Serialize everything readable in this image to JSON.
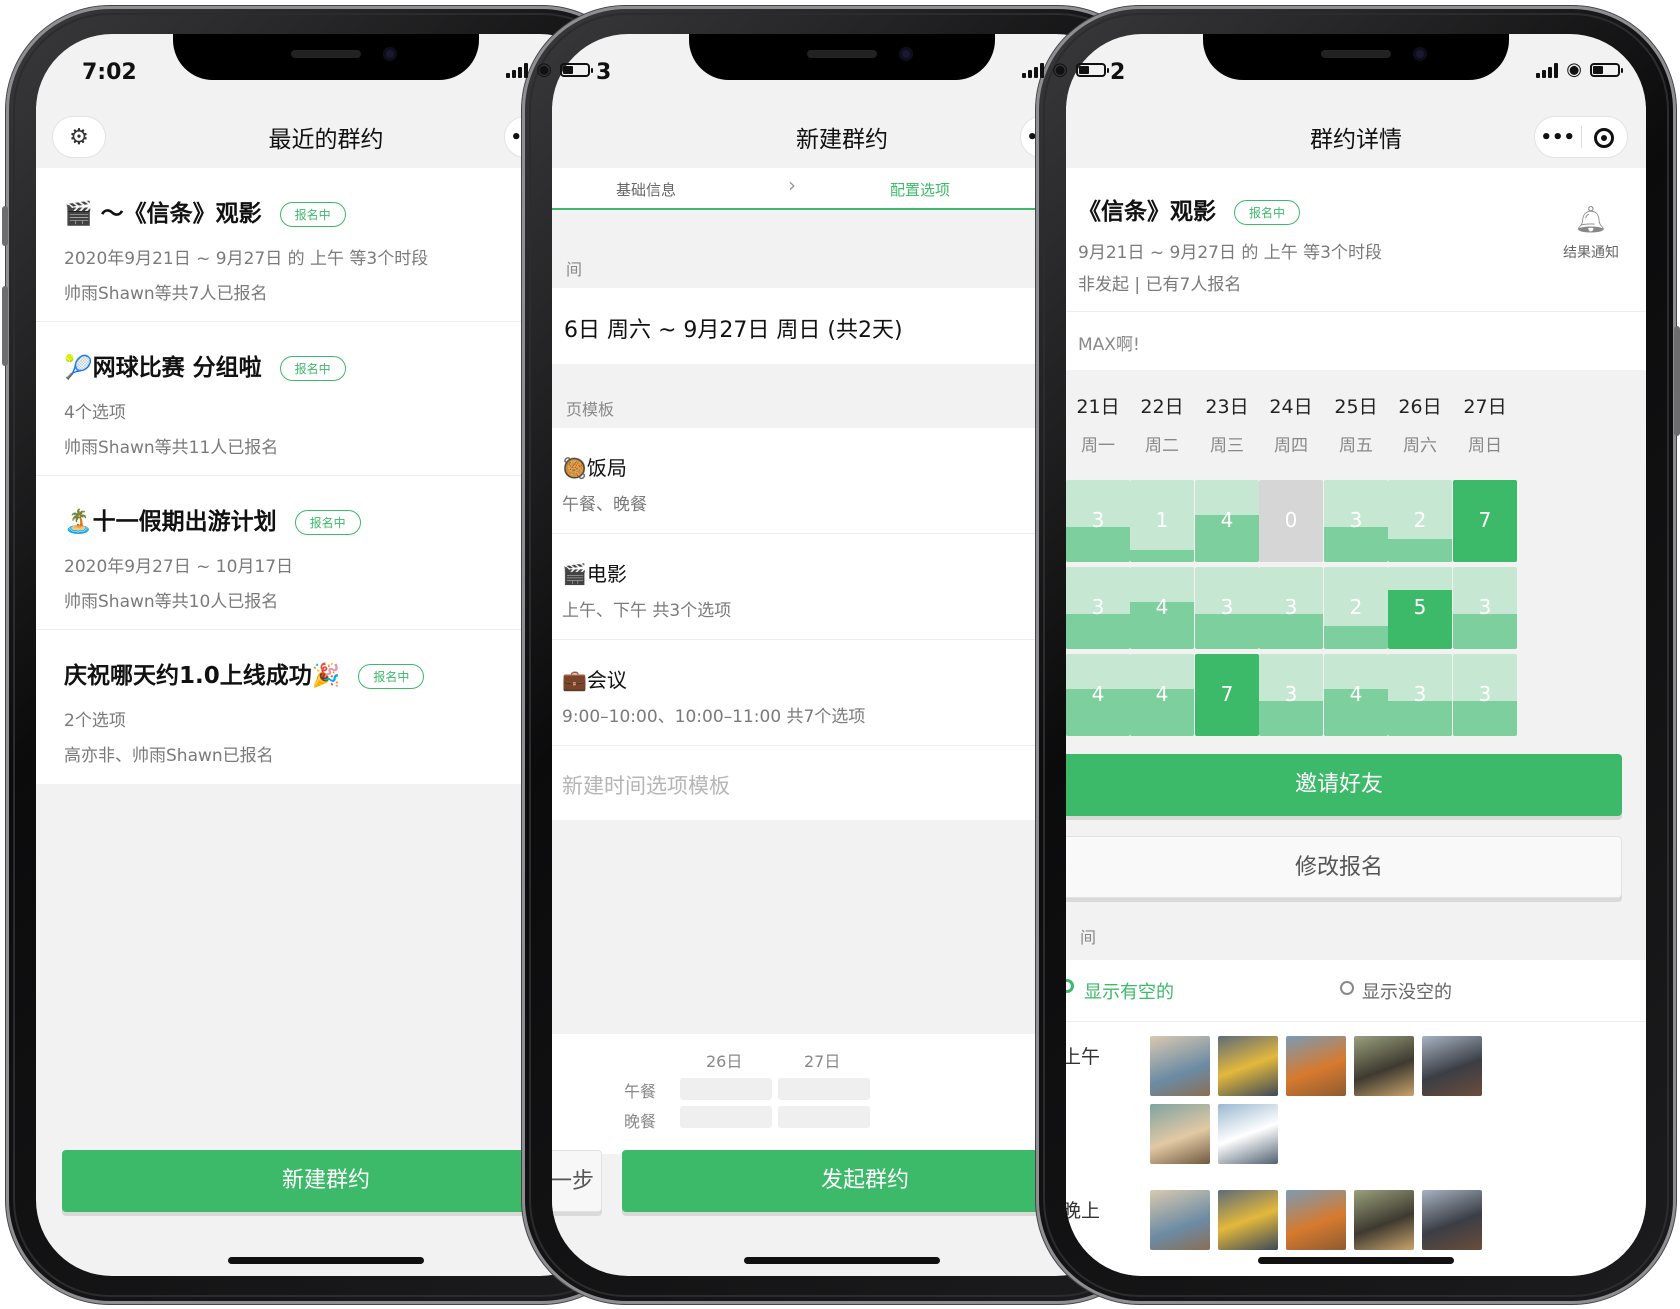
{
  "status": {
    "time": "7:02",
    "time2": "3",
    "time3": "2"
  },
  "phone1": {
    "title": "最近的群约",
    "items": [
      {
        "title": "🎬 ～《信条》观影",
        "badge": "报名中",
        "sub": "2020年9月21日 ~ 9月27日 的 上午 等3个时段",
        "sub2": "帅雨Shawn等共7人已报名"
      },
      {
        "title": "🎾网球比赛 分组啦",
        "badge": "报名中",
        "sub": "4个选项",
        "sub2": "帅雨Shawn等共11人已报名"
      },
      {
        "title": "🏝️十一假期出游计划",
        "badge": "报名中",
        "sub": "2020年9月27日 ~ 10月17日",
        "sub2": "帅雨Shawn等共10人已报名"
      },
      {
        "title": "庆祝哪天约1.0上线成功🎉",
        "badge": "报名中",
        "sub": "2个选项",
        "sub2": "高亦非、帅雨Shawn已报名"
      }
    ],
    "new_button": "新建群约"
  },
  "phone2": {
    "title": "新建群约",
    "step1": "基础信息",
    "step2": "配置选项",
    "label_date": "间",
    "date_range": "6日 周六 ~ 9月27日 周日 (共2天)",
    "label_template": "页模板",
    "templates": [
      {
        "name": "🥘饭局",
        "desc": "午餐、晚餐"
      },
      {
        "name": "🎬电影",
        "desc": "上午、下午 共3个选项"
      },
      {
        "name": "💼会议",
        "desc": "9:00–10:00、10:00–11:00 共7个选项"
      }
    ],
    "new_template": "新建时间选项模板",
    "preview": {
      "days": [
        "26日",
        "27日"
      ],
      "rows": [
        "午餐",
        "晚餐"
      ]
    },
    "prev_button": "一步",
    "submit_button": "发起群约"
  },
  "phone3": {
    "title": "群约详情",
    "event_title": "《信条》观影",
    "badge": "报名中",
    "sub": "9月21日 ~ 9月27日 的 上午 等3个时段",
    "sub2": "非发起 | 已有7人报名",
    "notify": "结果通知",
    "note": "MAX啊!",
    "days": [
      {
        "d": "21日",
        "w": "周一"
      },
      {
        "d": "22日",
        "w": "周二"
      },
      {
        "d": "23日",
        "w": "周三"
      },
      {
        "d": "24日",
        "w": "周四"
      },
      {
        "d": "25日",
        "w": "周五"
      },
      {
        "d": "26日",
        "w": "周六"
      },
      {
        "d": "27日",
        "w": "周日"
      }
    ],
    "grid": [
      [
        3,
        1,
        4,
        0,
        3,
        2,
        7
      ],
      [
        3,
        4,
        3,
        3,
        2,
        5,
        3
      ],
      [
        4,
        4,
        7,
        3,
        4,
        3,
        3
      ]
    ],
    "invite_button": "邀请好友",
    "edit_button": "修改报名",
    "section_label": "间",
    "filter_on": "显示有空的",
    "filter_off": "显示没空的",
    "slot1": "上午",
    "slot2": "晚上"
  }
}
